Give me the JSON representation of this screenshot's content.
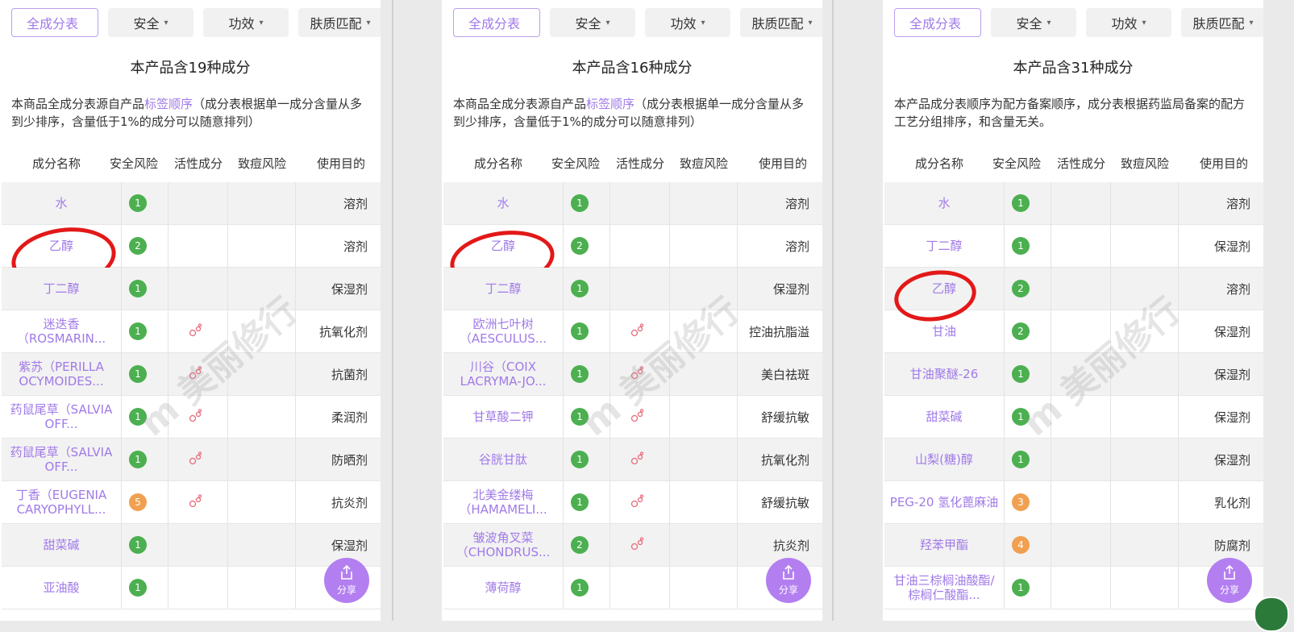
{
  "tabs": [
    {
      "label": "全成分表",
      "caret": ""
    },
    {
      "label": "安全",
      "caret": "▾"
    },
    {
      "label": "功效",
      "caret": "▾"
    },
    {
      "label": "肤质匹配",
      "caret": "▾"
    }
  ],
  "columns": [
    "成分名称",
    "安全风险",
    "活性成分",
    "致痘风险",
    "使用目的"
  ],
  "share_label": "分享",
  "share_icon": "share-icon",
  "watermark": "m 美丽修行",
  "score_colors": {
    "green": "#4caf50",
    "orange": "#f0a050"
  },
  "panels": [
    {
      "title": "本产品含19种成分",
      "desc_pre": "本商品全成分表源自产品",
      "desc_link": "标签顺序",
      "desc_post": "（成分表根据单一成分含量从多到少排序，含量低于1%的成分可以随意排列）",
      "rows": [
        {
          "name": "水",
          "score": "1",
          "color": "green",
          "active": false,
          "purpose": "溶剂"
        },
        {
          "name": "乙醇",
          "score": "2",
          "color": "green",
          "active": false,
          "purpose": "溶剂"
        },
        {
          "name": "丁二醇",
          "score": "1",
          "color": "green",
          "active": false,
          "purpose": "保湿剂"
        },
        {
          "name": "迷迭香（ROSMARIN...",
          "score": "1",
          "color": "green",
          "active": true,
          "purpose": "抗氧化剂"
        },
        {
          "name": "紫苏（PERILLA OCYMOIDES...",
          "score": "1",
          "color": "green",
          "active": true,
          "purpose": "抗菌剂"
        },
        {
          "name": "药鼠尾草（SALVIA OFF...",
          "score": "1",
          "color": "green",
          "active": true,
          "purpose": "柔润剂"
        },
        {
          "name": "药鼠尾草（SALVIA OFF...",
          "score": "1",
          "color": "green",
          "active": true,
          "purpose": "防晒剂"
        },
        {
          "name": "丁香（EUGENIA CARYOPHYLL...",
          "score": "5",
          "color": "orange",
          "active": true,
          "purpose": "抗炎剂"
        },
        {
          "name": "甜菜碱",
          "score": "1",
          "color": "green",
          "active": false,
          "purpose": "保湿剂"
        },
        {
          "name": "亚油酸",
          "score": "1",
          "color": "green",
          "active": false,
          "purpose": ""
        }
      ]
    },
    {
      "title": "本产品含16种成分",
      "desc_pre": "本商品全成分表源自产品",
      "desc_link": "标签顺序",
      "desc_post": "（成分表根据单一成分含量从多到少排序，含量低于1%的成分可以随意排列）",
      "rows": [
        {
          "name": "水",
          "score": "1",
          "color": "green",
          "active": false,
          "purpose": "溶剂"
        },
        {
          "name": "乙醇",
          "score": "2",
          "color": "green",
          "active": false,
          "purpose": "溶剂"
        },
        {
          "name": "丁二醇",
          "score": "1",
          "color": "green",
          "active": false,
          "purpose": "保湿剂"
        },
        {
          "name": "欧洲七叶树（AESCULUS...",
          "score": "1",
          "color": "green",
          "active": true,
          "purpose": "控油抗脂溢"
        },
        {
          "name": "川谷（COIX LACRYMA-JO...",
          "score": "1",
          "color": "green",
          "active": true,
          "purpose": "美白祛斑"
        },
        {
          "name": "甘草酸二钾",
          "score": "1",
          "color": "green",
          "active": true,
          "purpose": "舒缓抗敏"
        },
        {
          "name": "谷胱甘肽",
          "score": "1",
          "color": "green",
          "active": true,
          "purpose": "抗氧化剂"
        },
        {
          "name": "北美金缕梅（HAMAMELI...",
          "score": "1",
          "color": "green",
          "active": true,
          "purpose": "舒缓抗敏"
        },
        {
          "name": "皱波角叉菜（CHONDRUS...",
          "score": "2",
          "color": "green",
          "active": true,
          "purpose": "抗炎剂"
        },
        {
          "name": "薄荷醇",
          "score": "1",
          "color": "green",
          "active": false,
          "purpose": ""
        }
      ]
    },
    {
      "title": "本产品含31种成分",
      "desc_pre": "本产品成分表顺序为配方备案顺序，成分表根据药监局备案的配方工艺分组排序，和含量无关。",
      "desc_link": "",
      "desc_post": "",
      "rows": [
        {
          "name": "水",
          "score": "1",
          "color": "green",
          "active": false,
          "purpose": "溶剂"
        },
        {
          "name": "丁二醇",
          "score": "1",
          "color": "green",
          "active": false,
          "purpose": "保湿剂"
        },
        {
          "name": "乙醇",
          "score": "2",
          "color": "green",
          "active": false,
          "purpose": "溶剂"
        },
        {
          "name": "甘油",
          "score": "2",
          "color": "green",
          "active": false,
          "purpose": "保湿剂"
        },
        {
          "name": "甘油聚醚-26",
          "score": "1",
          "color": "green",
          "active": false,
          "purpose": "保湿剂"
        },
        {
          "name": "甜菜碱",
          "score": "1",
          "color": "green",
          "active": false,
          "purpose": "保湿剂"
        },
        {
          "name": "山梨(糖)醇",
          "score": "1",
          "color": "green",
          "active": false,
          "purpose": "保湿剂"
        },
        {
          "name": "PEG-20 氢化蓖麻油",
          "score": "3",
          "color": "orange",
          "active": false,
          "purpose": "乳化剂"
        },
        {
          "name": "羟苯甲酯",
          "score": "4",
          "color": "orange",
          "active": false,
          "purpose": "防腐剂"
        },
        {
          "name": "甘油三棕榈油酸酯/棕榈仁酸酯...",
          "score": "1",
          "color": "green",
          "active": false,
          "purpose": ""
        }
      ]
    }
  ]
}
